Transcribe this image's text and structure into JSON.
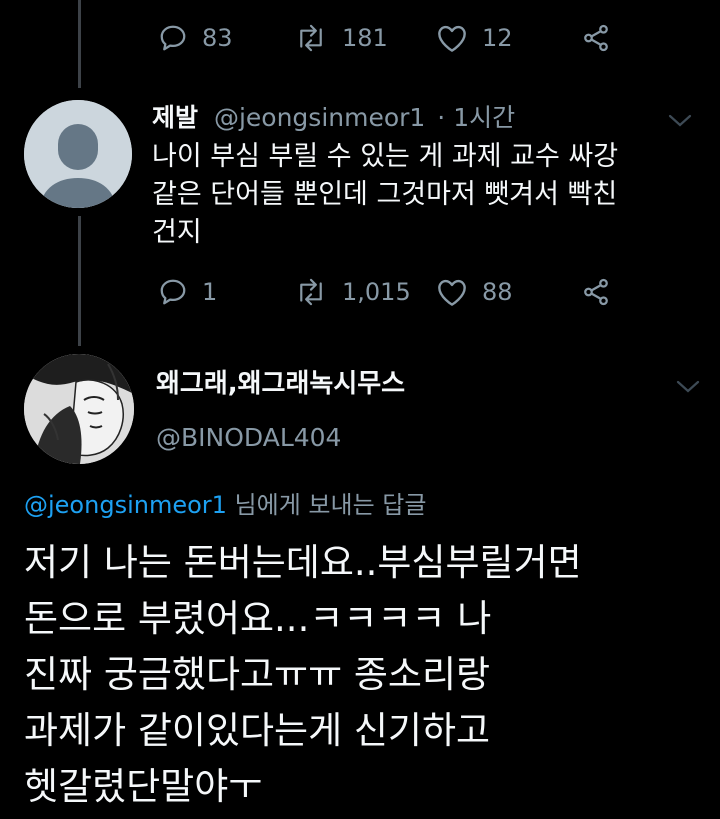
{
  "top_tweet": {
    "replies": "83",
    "retweets": "181",
    "likes": "12"
  },
  "tweet": {
    "name": "제발",
    "handle": "@jeongsinmeor1",
    "time": "· 1시간",
    "text": "나이 부심 부릴 수 있는 게 과제 교수 싸강\n같은 단어들 뿐인데 그것마저 뺏겨서 빡친\n건지",
    "replies": "1",
    "retweets": "1,015",
    "likes": "88"
  },
  "reply": {
    "name": "왜그래,왜그래녹시무스",
    "handle": "@BINODAL404",
    "reply_to_mention": "@jeongsinmeor1",
    "reply_to_suffix": " 님에게 보내는 답글",
    "text": "저기 나는 돈버는데요..부심부릴거면\n돈으로 부렸어요...ㅋㅋㅋㅋ 나\n진짜 궁금했다고ㅠㅠ 종소리랑\n과제가 같이있다는게 신기하고\n헷갈렸단말야ㅜ"
  },
  "icons": {
    "reply": "speech-bubble-icon",
    "retweet": "retweet-arrows-icon",
    "like": "heart-outline-icon",
    "share": "share-nodes-icon",
    "caret": "chevron-down-icon"
  },
  "colors": {
    "background": "#000000",
    "text": "#f5f8fa",
    "muted": "#8899a6",
    "link": "#1da1f2",
    "thread_line": "#3d4248"
  }
}
